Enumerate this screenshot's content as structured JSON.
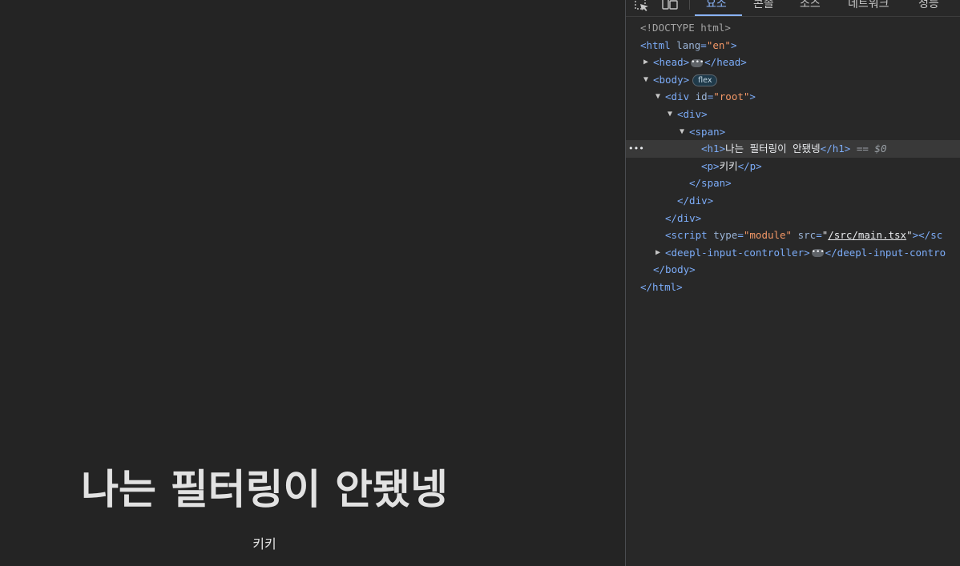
{
  "page": {
    "heading": "나는 필터링이 안됐넹",
    "paragraph": "키키"
  },
  "devtools": {
    "toolbar_icons": [
      "inspect-element-icon",
      "device-toolbar-icon"
    ],
    "tabs": [
      {
        "label": "요소",
        "active": true
      },
      {
        "label": "콘솔",
        "active": false
      },
      {
        "label": "소스",
        "active": false
      },
      {
        "label": "네트워크",
        "active": false
      },
      {
        "label": "성능",
        "active": false
      }
    ],
    "tree": {
      "doctype": "<!DOCTYPE html>",
      "html_open": "<html",
      "html_attr": "lang",
      "html_attr_val": "en",
      "html_open_end": ">",
      "head_open": "<head>",
      "head_close": "</head>",
      "body_open": "<body>",
      "body_badge": "flex",
      "div_root_open": "<div",
      "div_root_attr": "id",
      "div_root_val": "root",
      "div_root_end": ">",
      "div_open": "<div>",
      "span_open": "<span>",
      "h1_open": "<h1>",
      "h1_text": "나는 필터링이 안됐넹",
      "h1_close": "</h1>",
      "dollar": "== $0",
      "p_open": "<p>",
      "p_text": "키키",
      "p_close": "</p>",
      "span_close": "</span>",
      "div_close": "</div>",
      "root_close": "</div>",
      "script_open": "<script",
      "script_attr1": "type",
      "script_val1": "module",
      "script_attr2": "src",
      "script_val2": "/src/main.tsx",
      "script_tail": "></sc",
      "deepl_open": "<deepl-input-controller>",
      "deepl_close": "</deepl-input-contro",
      "body_close": "</body>",
      "html_close": "</html>"
    }
  },
  "colors": {
    "page_bg": "#242424",
    "devtools_bg": "#282828",
    "tag": "#7cacf8",
    "attr_value": "#f29766",
    "active_tab": "#8ab4f8"
  }
}
